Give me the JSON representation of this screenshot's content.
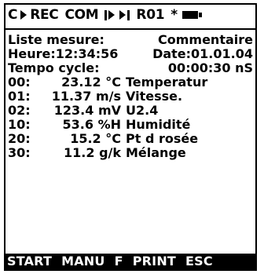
{
  "status_bar": {
    "channel": "C",
    "rec": "REC",
    "com": "COM",
    "routine": "R01",
    "star": "*",
    "icons": [
      "play-icon",
      "pause-play-icon",
      "skip-forward-icon",
      "battery-icon"
    ]
  },
  "header": {
    "list_label": "Liste mesure:",
    "comment_label": "Commentaire",
    "time": "Heure:12:34:56",
    "date": "Date:01.01.04",
    "cycle_label": "Tempo cycle:",
    "cycle_value": "00:00:30 nS"
  },
  "measurements": [
    {
      "channel": "00:",
      "value": "23.12 °C",
      "description": "Temperatur"
    },
    {
      "channel": "01:",
      "value": "11.37 m/s",
      "description": "Vitesse."
    },
    {
      "channel": "02:",
      "value": "123.4 mV",
      "description": "U2.4"
    },
    {
      "channel": "10:",
      "value": "53.6 %H",
      "description": "Humidité"
    },
    {
      "channel": "20:",
      "value": "15.2 °C",
      "description": "Pt d rosée"
    },
    {
      "channel": "30:",
      "value": "11.2 g/k",
      "description": "Mélange"
    }
  ],
  "softkeys": [
    "START",
    "MANU",
    "F",
    "PRINT",
    "ESC"
  ]
}
